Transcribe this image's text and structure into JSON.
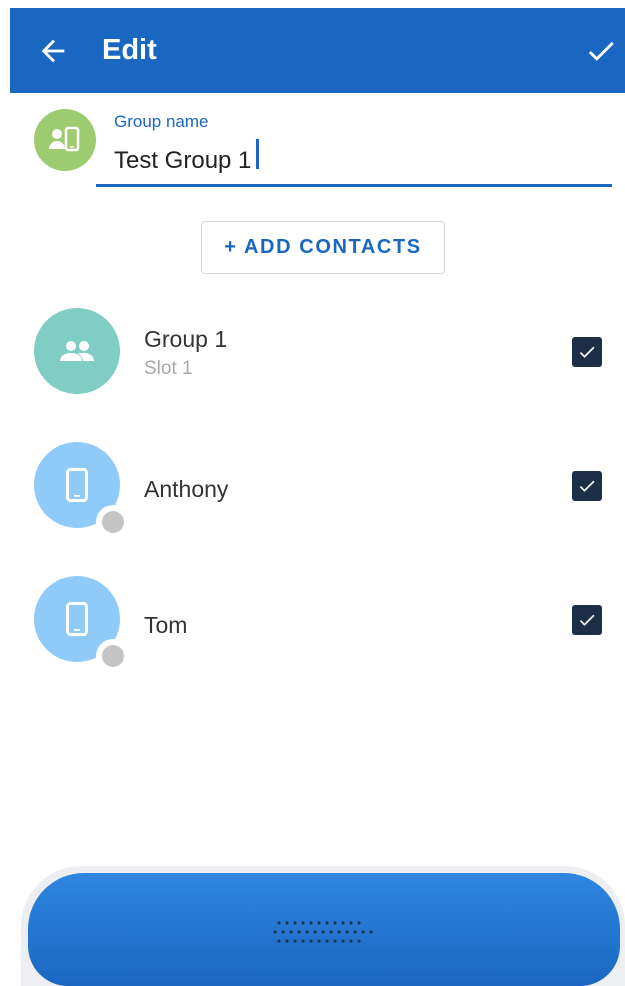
{
  "appbar": {
    "title": "Edit",
    "back_icon": "arrow-left-icon",
    "confirm_icon": "check-icon",
    "color": "#1a67c1"
  },
  "group_field": {
    "label": "Group name",
    "value": "Test Group 1",
    "avatar_icon": "contact-phone-icon",
    "avatar_color": "#9ccc6f"
  },
  "add_contacts": {
    "label": "+ ADD CONTACTS"
  },
  "contacts": [
    {
      "name": "Group 1",
      "subtitle": "Slot 1",
      "icon": "people-icon",
      "avatar_color": "#7fcdc3",
      "checked": true
    },
    {
      "name": "Anthony",
      "icon": "smartphone-icon",
      "avatar_color": "#90caf9",
      "status": "offline",
      "checked": true
    },
    {
      "name": "Tom",
      "icon": "smartphone-icon",
      "avatar_color": "#90caf9",
      "status": "offline",
      "checked": true
    }
  ],
  "bottom_bar": {
    "icon": "keypad-dots-icon"
  }
}
